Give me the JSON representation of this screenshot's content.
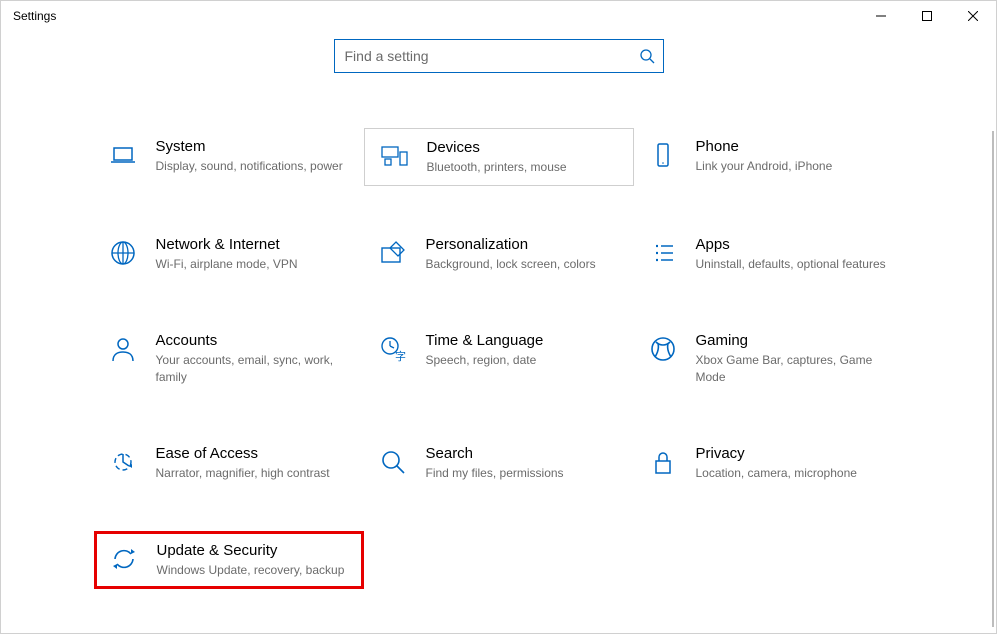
{
  "window": {
    "title": "Settings"
  },
  "search": {
    "placeholder": "Find a setting"
  },
  "categories": [
    {
      "id": "system",
      "title": "System",
      "desc": "Display, sound, notifications, power",
      "icon": "laptop",
      "selected": false,
      "highlighted": false
    },
    {
      "id": "devices",
      "title": "Devices",
      "desc": "Bluetooth, printers, mouse",
      "icon": "devices",
      "selected": true,
      "highlighted": false
    },
    {
      "id": "phone",
      "title": "Phone",
      "desc": "Link your Android, iPhone",
      "icon": "phone",
      "selected": false,
      "highlighted": false
    },
    {
      "id": "network",
      "title": "Network & Internet",
      "desc": "Wi-Fi, airplane mode, VPN",
      "icon": "globe",
      "selected": false,
      "highlighted": false
    },
    {
      "id": "personalization",
      "title": "Personalization",
      "desc": "Background, lock screen, colors",
      "icon": "pen-monitor",
      "selected": false,
      "highlighted": false
    },
    {
      "id": "apps",
      "title": "Apps",
      "desc": "Uninstall, defaults, optional features",
      "icon": "list",
      "selected": false,
      "highlighted": false
    },
    {
      "id": "accounts",
      "title": "Accounts",
      "desc": "Your accounts, email, sync, work, family",
      "icon": "person",
      "selected": false,
      "highlighted": false
    },
    {
      "id": "time",
      "title": "Time & Language",
      "desc": "Speech, region, date",
      "icon": "clock-lang",
      "selected": false,
      "highlighted": false
    },
    {
      "id": "gaming",
      "title": "Gaming",
      "desc": "Xbox Game Bar, captures, Game Mode",
      "icon": "xbox",
      "selected": false,
      "highlighted": false
    },
    {
      "id": "ease",
      "title": "Ease of Access",
      "desc": "Narrator, magnifier, high contrast",
      "icon": "ease",
      "selected": false,
      "highlighted": false
    },
    {
      "id": "search-cat",
      "title": "Search",
      "desc": "Find my files, permissions",
      "icon": "magnifier",
      "selected": false,
      "highlighted": false
    },
    {
      "id": "privacy",
      "title": "Privacy",
      "desc": "Location, camera, microphone",
      "icon": "lock",
      "selected": false,
      "highlighted": false
    },
    {
      "id": "update",
      "title": "Update & Security",
      "desc": "Windows Update, recovery, backup",
      "icon": "sync",
      "selected": false,
      "highlighted": true
    }
  ],
  "colors": {
    "accent": "#0067c0",
    "highlight": "#e60000"
  }
}
